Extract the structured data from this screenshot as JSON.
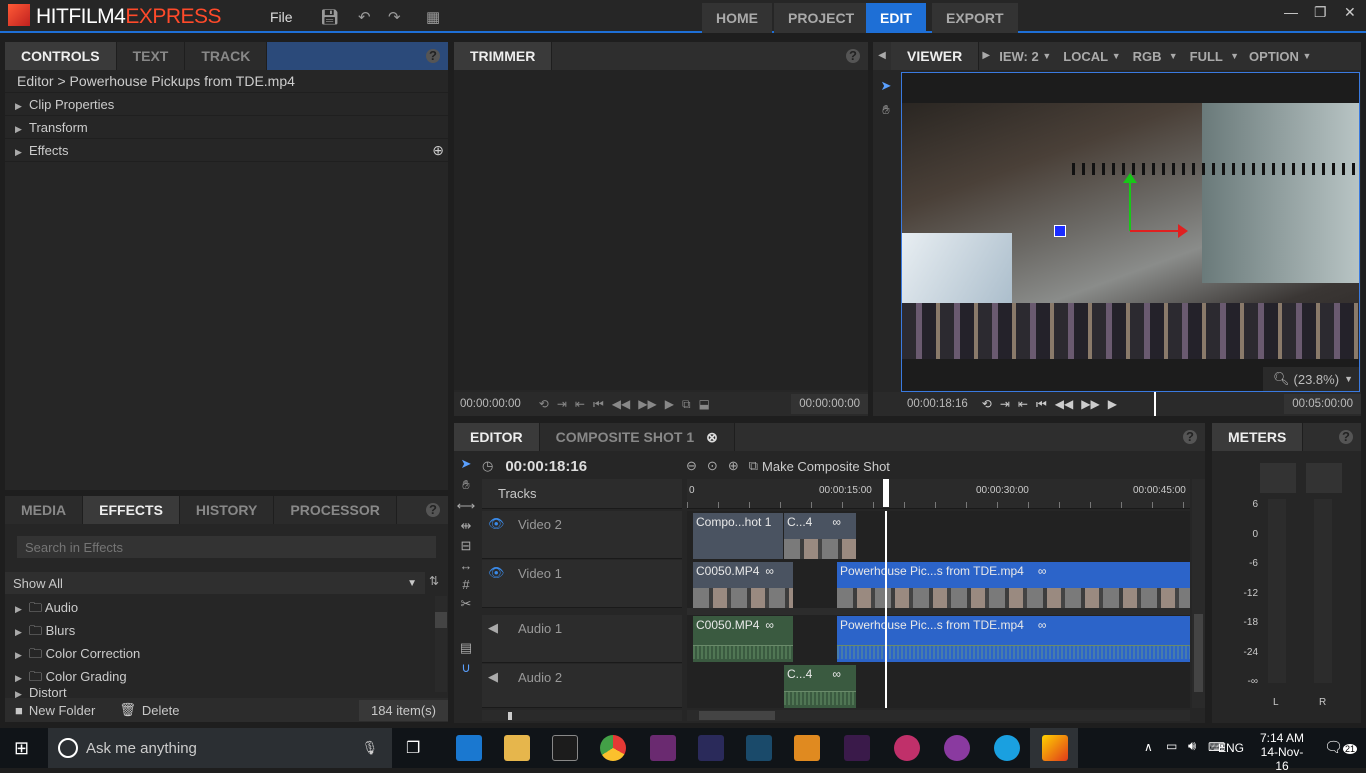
{
  "app": {
    "logo_main": "HITFILM4",
    "logo_sub": "EXPRESS",
    "file_menu": "File"
  },
  "nav": [
    "HOME",
    "PROJECT",
    "EDIT",
    "EXPORT"
  ],
  "controls": {
    "tabs": [
      "CONTROLS",
      "TEXT",
      "TRACK"
    ],
    "breadcrumb": "Editor > Powerhouse Pickups from TDE.mp4",
    "items": [
      "Clip Properties",
      "Transform",
      "Effects"
    ]
  },
  "effects_panel": {
    "tabs": [
      "MEDIA",
      "EFFECTS",
      "HISTORY",
      "PROCESSOR"
    ],
    "search_placeholder": "Search in Effects",
    "filter": "Show All",
    "folders": [
      "Audio",
      "Blurs",
      "Color Correction",
      "Color Grading",
      "Distort"
    ],
    "new_folder": "New Folder",
    "delete": "Delete",
    "count": "184 item(s)"
  },
  "trimmer": {
    "title": "TRIMMER",
    "tc_in": "00:00:00:00",
    "tc_out": "00:00:00:00"
  },
  "viewer": {
    "title": "VIEWER",
    "view": "IEW: 2",
    "local": "LOCAL",
    "rgb": "RGB",
    "full": "FULL",
    "options": "OPTION",
    "zoom": "(23.8%)",
    "tc_current": "00:00:18:16",
    "tc_end": "00:05:00:00"
  },
  "editor": {
    "tabs": [
      "EDITOR",
      "COMPOSITE SHOT 1"
    ],
    "timecode": "00:00:18:16",
    "make_composite": "Make Composite Shot",
    "tracks_label": "Tracks",
    "ruler": [
      "0",
      "00:00:15:00",
      "00:00:30:00",
      "00:00:45:00"
    ],
    "tracks": [
      "Video 2",
      "Video 1",
      "Audio 1",
      "Audio 2"
    ],
    "clips": {
      "v2a": "Compo...hot 1",
      "v2b": "C...4",
      "v1a": "C0050.MP4",
      "v1b": "Powerhouse Pic...s from TDE.mp4",
      "a1a": "C0050.MP4",
      "a1b": "Powerhouse Pic...s from TDE.mp4",
      "a2a": "C...4"
    }
  },
  "meters": {
    "title": "METERS",
    "scale": [
      "6",
      "0",
      "-6",
      "-12",
      "-18",
      "-24",
      "-∞"
    ],
    "left": "L",
    "right": "R"
  },
  "taskbar": {
    "search": "Ask me anything",
    "lang": "ENG",
    "time": "7:14 AM",
    "date": "14-Nov-16",
    "notif": "21"
  }
}
